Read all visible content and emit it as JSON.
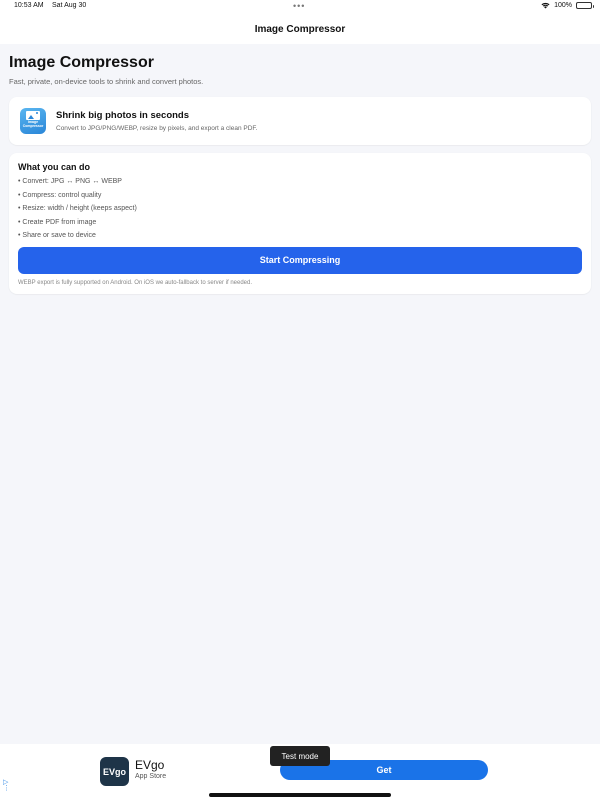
{
  "status_bar": {
    "time": "10:53 AM",
    "date": "Sat Aug 30",
    "battery": "100%"
  },
  "nav": {
    "title": "Image Compressor"
  },
  "main": {
    "title": "Image Compressor",
    "subtitle": "Fast, private, on-device tools to shrink and convert photos.",
    "hero": {
      "icon_text": "Image Compressor",
      "title": "Shrink big photos in seconds",
      "subtitle": "Convert to JPG/PNG/WEBP, resize by pixels, and export a clean PDF."
    },
    "features": {
      "title": "What you can do",
      "items": [
        "• Convert: JPG ↔ PNG ↔ WEBP",
        "• Compress: control quality",
        "• Resize: width / height (keeps aspect)",
        "• Create PDF from image",
        "• Share or save to device"
      ],
      "button_label": "Start Compressing",
      "footnote": "WEBP export is fully supported on Android. On iOS we auto-fallback to server if needed."
    }
  },
  "ad": {
    "logo_text": "EVgo",
    "name": "EVgo",
    "store": "App Store",
    "button_label": "Get",
    "test_mode": "Test mode"
  },
  "colors": {
    "accent": "#2563eb",
    "background": "#f5f6fa",
    "ad_button": "#1a73e8"
  }
}
